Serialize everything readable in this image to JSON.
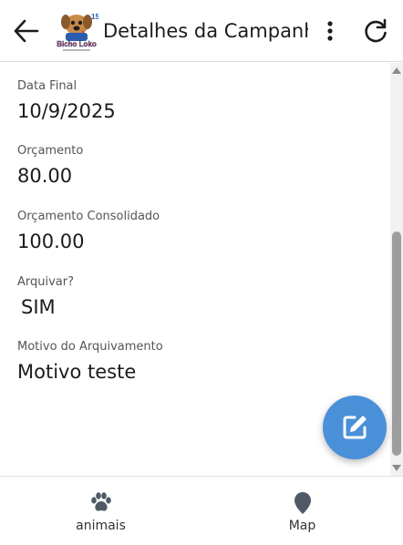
{
  "header": {
    "title": "Detalhes da Campanha",
    "logo_text": "Bicho Loko",
    "icons": {
      "back": "arrow-left-icon",
      "menu": "dots-vertical-icon",
      "refresh": "refresh-icon"
    }
  },
  "fields": [
    {
      "label": "Data Final",
      "value": "10/9/2025"
    },
    {
      "label": "Orçamento",
      "value": "80.00"
    },
    {
      "label": "Orçamento Consolidado",
      "value": "100.00"
    },
    {
      "label": "Arquivar?",
      "value": "SIM"
    },
    {
      "label": "Motivo do Arquivamento",
      "value": "Motivo teste"
    }
  ],
  "fab": {
    "icon": "edit-icon",
    "color": "#4a90d9"
  },
  "bottom_nav": {
    "items": [
      {
        "label": "animais",
        "icon": "paw-icon"
      },
      {
        "label": "Map",
        "icon": "map-marker-icon"
      }
    ]
  }
}
